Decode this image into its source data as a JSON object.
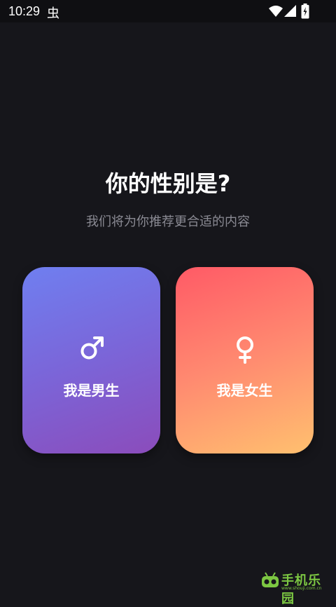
{
  "status_bar": {
    "time": "10:29",
    "notification_icon": "bug-icon",
    "wifi_icon": "wifi-icon",
    "signal_icon": "cell-signal-icon",
    "battery_icon": "battery-charging-icon"
  },
  "page": {
    "title": "你的性别是?",
    "subtitle": "我们将为你推荐更合适的内容"
  },
  "options": {
    "male": {
      "label": "我是男生",
      "icon": "male-symbol-icon",
      "gradient": [
        "#6f7ff0",
        "#8b4cbb"
      ]
    },
    "female": {
      "label": "我是女生",
      "icon": "female-symbol-icon",
      "gradient": [
        "#ff5a66",
        "#ffc06f"
      ]
    }
  },
  "watermark": {
    "text": "手机乐园",
    "sub": "www.shouji.com.cn"
  },
  "colors": {
    "background": "#16161b",
    "subtitle": "#8a8a93"
  }
}
